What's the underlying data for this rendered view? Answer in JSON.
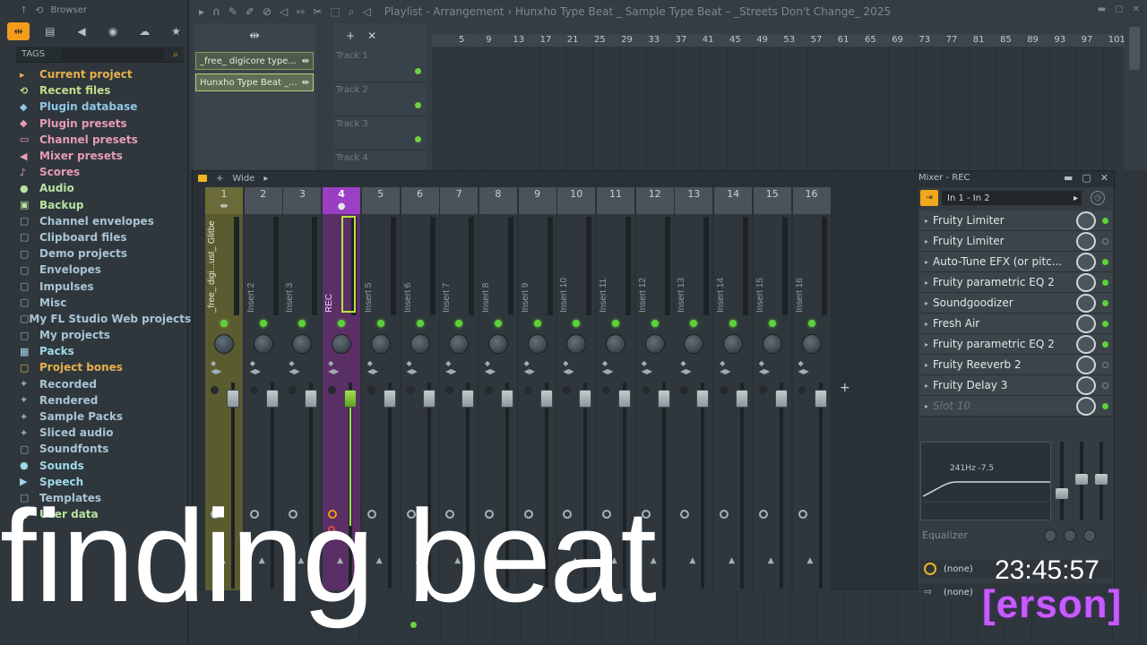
{
  "browser": {
    "title": "Browser",
    "tags_label": "TAGS",
    "items": [
      {
        "label": "Current project",
        "icon": "project-icon",
        "glyph": "▸",
        "color": "c-orange"
      },
      {
        "label": "Recent files",
        "icon": "recent-icon",
        "glyph": "⟲",
        "color": "c-green"
      },
      {
        "label": "Plugin database",
        "icon": "plug-icon",
        "glyph": "◆",
        "color": "c-blue"
      },
      {
        "label": "Plugin presets",
        "icon": "plug-icon",
        "glyph": "◆",
        "color": "c-pink"
      },
      {
        "label": "Channel presets",
        "icon": "channel-icon",
        "glyph": "▭",
        "color": "c-pink"
      },
      {
        "label": "Mixer presets",
        "icon": "mixer-icon",
        "glyph": "◀",
        "color": "c-pink"
      },
      {
        "label": "Scores",
        "icon": "note-icon",
        "glyph": "♪",
        "color": "c-pink"
      },
      {
        "label": "Audio",
        "icon": "person-icon",
        "glyph": "●",
        "color": "c-lgreen"
      },
      {
        "label": "Backup",
        "icon": "backup-icon",
        "glyph": "▣",
        "color": "c-lgreen"
      },
      {
        "label": "Channel envelopes",
        "icon": "folder-icon",
        "glyph": "▢",
        "color": "c-grey"
      },
      {
        "label": "Clipboard files",
        "icon": "folder-icon",
        "glyph": "▢",
        "color": "c-grey"
      },
      {
        "label": "Demo projects",
        "icon": "folder-icon",
        "glyph": "▢",
        "color": "c-grey"
      },
      {
        "label": "Envelopes",
        "icon": "folder-icon",
        "glyph": "▢",
        "color": "c-grey"
      },
      {
        "label": "Impulses",
        "icon": "folder-icon",
        "glyph": "▢",
        "color": "c-grey"
      },
      {
        "label": "Misc",
        "icon": "folder-icon",
        "glyph": "▢",
        "color": "c-grey"
      },
      {
        "label": "My FL Studio Web projects",
        "icon": "folder-icon",
        "glyph": "▢",
        "color": "c-grey"
      },
      {
        "label": "My projects",
        "icon": "folder-icon",
        "glyph": "▢",
        "color": "c-grey"
      },
      {
        "label": "Packs",
        "icon": "packs-icon",
        "glyph": "▦",
        "color": "c-cyan"
      },
      {
        "label": "Project bones",
        "icon": "folder-icon",
        "glyph": "▢",
        "color": "c-orange"
      },
      {
        "label": "Recorded",
        "icon": "sparkle-icon",
        "glyph": "✦",
        "color": "c-grey"
      },
      {
        "label": "Rendered",
        "icon": "sparkle-icon",
        "glyph": "✦",
        "color": "c-grey"
      },
      {
        "label": "Sample Packs",
        "icon": "sparkle-icon",
        "glyph": "✦",
        "color": "c-grey"
      },
      {
        "label": "Sliced audio",
        "icon": "sparkle-icon",
        "glyph": "✦",
        "color": "c-grey"
      },
      {
        "label": "Soundfonts",
        "icon": "folder-icon",
        "glyph": "▢",
        "color": "c-grey"
      },
      {
        "label": "Sounds",
        "icon": "sounds-icon",
        "glyph": "●",
        "color": "c-cyan"
      },
      {
        "label": "Speech",
        "icon": "speech-icon",
        "glyph": "▶",
        "color": "c-cyan"
      },
      {
        "label": "Templates",
        "icon": "folder-icon",
        "glyph": "▢",
        "color": "c-grey"
      },
      {
        "label": "User data",
        "icon": "user-icon",
        "glyph": "●",
        "color": "c-lgreen"
      }
    ]
  },
  "playlist": {
    "title": "Playlist - Arrangement",
    "separator": "›",
    "project": "Hunxho Type Beat _ Sample Type Beat – _Streets Don't Change_ 2025",
    "patterns": [
      "_free_ digicore type...",
      "Hunxho Type Beat _..."
    ],
    "tracks": [
      "Track 1",
      "Track 2",
      "Track 3",
      "Track 4"
    ],
    "bars": [
      "5",
      "9",
      "13",
      "17",
      "21",
      "25",
      "29",
      "33",
      "37",
      "41",
      "45",
      "49",
      "53",
      "57",
      "61",
      "65",
      "69",
      "73",
      "77",
      "81",
      "85",
      "89",
      "93",
      "97",
      "101"
    ]
  },
  "mixer": {
    "title": "Wide",
    "panel_title": "Mixer - REC",
    "tracks": [
      {
        "num": "1",
        "name": "_free_ digi...ust_ Glitbe",
        "kind": "master"
      },
      {
        "num": "2",
        "name": "Insert 2",
        "kind": "normal"
      },
      {
        "num": "3",
        "name": "Insert 3",
        "kind": "normal"
      },
      {
        "num": "4",
        "name": "REC",
        "kind": "rec"
      },
      {
        "num": "5",
        "name": "Insert 5",
        "kind": "normal"
      },
      {
        "num": "6",
        "name": "Insert 6",
        "kind": "normal"
      },
      {
        "num": "7",
        "name": "Insert 7",
        "kind": "normal"
      },
      {
        "num": "8",
        "name": "Insert 8",
        "kind": "normal"
      },
      {
        "num": "9",
        "name": "Insert 9",
        "kind": "normal"
      },
      {
        "num": "10",
        "name": "Insert 10",
        "kind": "normal"
      },
      {
        "num": "11",
        "name": "Insert 11",
        "kind": "normal"
      },
      {
        "num": "12",
        "name": "Insert 12",
        "kind": "normal"
      },
      {
        "num": "13",
        "name": "Insert 13",
        "kind": "normal"
      },
      {
        "num": "14",
        "name": "Insert 14",
        "kind": "normal"
      },
      {
        "num": "15",
        "name": "Insert 15",
        "kind": "normal"
      },
      {
        "num": "16",
        "name": "Insert 16",
        "kind": "normal"
      }
    ],
    "route": "In 1 - In 2",
    "fx_slots": [
      {
        "name": "Fruity Limiter",
        "on": true
      },
      {
        "name": "Fruity Limiter",
        "on": false
      },
      {
        "name": "Auto-Tune EFX (or pitc...",
        "on": true
      },
      {
        "name": "Fruity parametric EQ 2",
        "on": true
      },
      {
        "name": "Soundgoodizer",
        "on": true
      },
      {
        "name": "Fresh Air",
        "on": true
      },
      {
        "name": "Fruity parametric EQ 2",
        "on": true
      },
      {
        "name": "Fruity Reeverb 2",
        "on": false
      },
      {
        "name": "Fruity Delay 3",
        "on": false
      },
      {
        "name": "Slot 10",
        "on": true,
        "empty": true
      }
    ],
    "eq_label": "241Hz -7.5",
    "eq_name": "Equalizer",
    "output_1": "(none)",
    "output_2": "(none)"
  },
  "overlay": {
    "caption": "finding beat",
    "clock": "23:45:57",
    "brand": "[erson]"
  }
}
